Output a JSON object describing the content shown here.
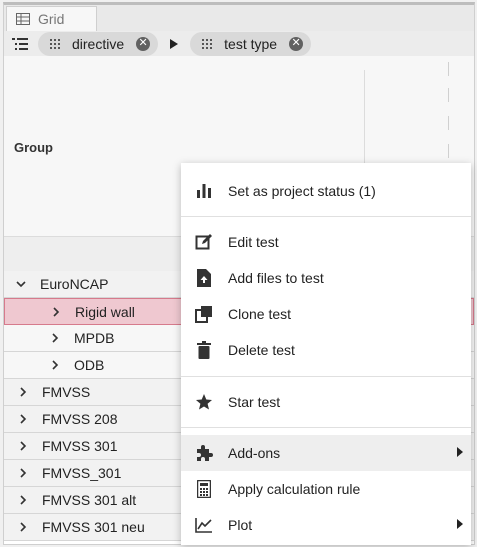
{
  "tab": {
    "label": "Grid",
    "icon": "table-icon"
  },
  "grouping": {
    "icon": "list-indent-icon",
    "chips": [
      {
        "label": "directive",
        "icon": "drag-handle-icon"
      },
      {
        "label": "test type",
        "icon": "drag-handle-icon"
      }
    ],
    "separator_icon": "triangle-right-icon"
  },
  "header": {
    "group_label": "Group"
  },
  "rows": [
    {
      "label": "EuroNCAP",
      "level": 0,
      "expanded": true
    },
    {
      "label": "Rigid wall",
      "level": 1,
      "expanded": false,
      "selected": true
    },
    {
      "label": "MPDB",
      "level": 1,
      "expanded": false
    },
    {
      "label": "ODB",
      "level": 1,
      "expanded": false
    },
    {
      "label": "FMVSS",
      "level": 0,
      "expanded": false
    },
    {
      "label": "FMVSS 208",
      "level": 0,
      "expanded": false
    },
    {
      "label": "FMVSS 301",
      "level": 0,
      "expanded": false
    },
    {
      "label": "FMVSS_301",
      "level": 0,
      "expanded": false
    },
    {
      "label": "FMVSS 301 alt",
      "level": 0,
      "expanded": false
    },
    {
      "label": "FMVSS 301 neu",
      "level": 0,
      "expanded": false
    }
  ],
  "context_menu": {
    "items": [
      {
        "label": "Set as project status (1)",
        "icon": "bar-chart-icon"
      },
      {
        "label": "Edit test",
        "icon": "edit-icon"
      },
      {
        "label": "Add files to test",
        "icon": "file-upload-icon"
      },
      {
        "label": "Clone test",
        "icon": "copy-icon"
      },
      {
        "label": "Delete test",
        "icon": "trash-icon"
      },
      {
        "label": "Star test",
        "icon": "star-icon"
      },
      {
        "label": "Add-ons",
        "icon": "puzzle-icon",
        "submenu": true
      },
      {
        "label": "Apply calculation rule",
        "icon": "calculator-icon"
      },
      {
        "label": "Plot",
        "icon": "line-chart-icon",
        "submenu": true
      }
    ]
  },
  "colors": {
    "selected_row_bg": "#efc8d0",
    "selected_row_border": "#d67a8c",
    "hover_item_bg": "#eeeeee"
  }
}
